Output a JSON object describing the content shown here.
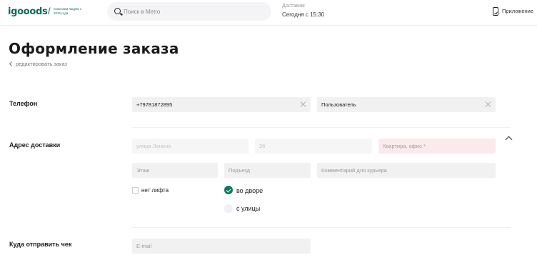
{
  "header": {
    "logo": "igooods",
    "logo_slash": "/",
    "logo_tagline": "помогаем людям с 2015 года",
    "search_placeholder": "Поиск в Metro",
    "delivery_label": "Доставим",
    "delivery_time": "Сегодня с 15:30",
    "app_label": "Приложение"
  },
  "page": {
    "title": "Оформление заказа",
    "back_link": "редактировать заказ"
  },
  "phone_section": {
    "label": "Телефон",
    "phone_value": "+79781872895",
    "name_value": "Пользователь"
  },
  "address_section": {
    "label": "Адрес доставки",
    "street_placeholder": "улица Ленина",
    "house_placeholder": "26",
    "apartment_placeholder": "Квартира, офис *",
    "floor_placeholder": "Этаж",
    "entrance_placeholder": "Подъезд",
    "comment_placeholder": "Комментарий для курьера",
    "no_elevator_label": "нет лифта",
    "courtyard_label": "во дворе",
    "street_entry_label": "с улицы",
    "selected_entry": "во дворе"
  },
  "receipt_section": {
    "label": "Куда отправить чек",
    "email_placeholder": "E-mail"
  },
  "colors": {
    "brand": "#0d6b5a",
    "accent": "#0f7a5f",
    "error_bg": "#fbe9ec"
  }
}
